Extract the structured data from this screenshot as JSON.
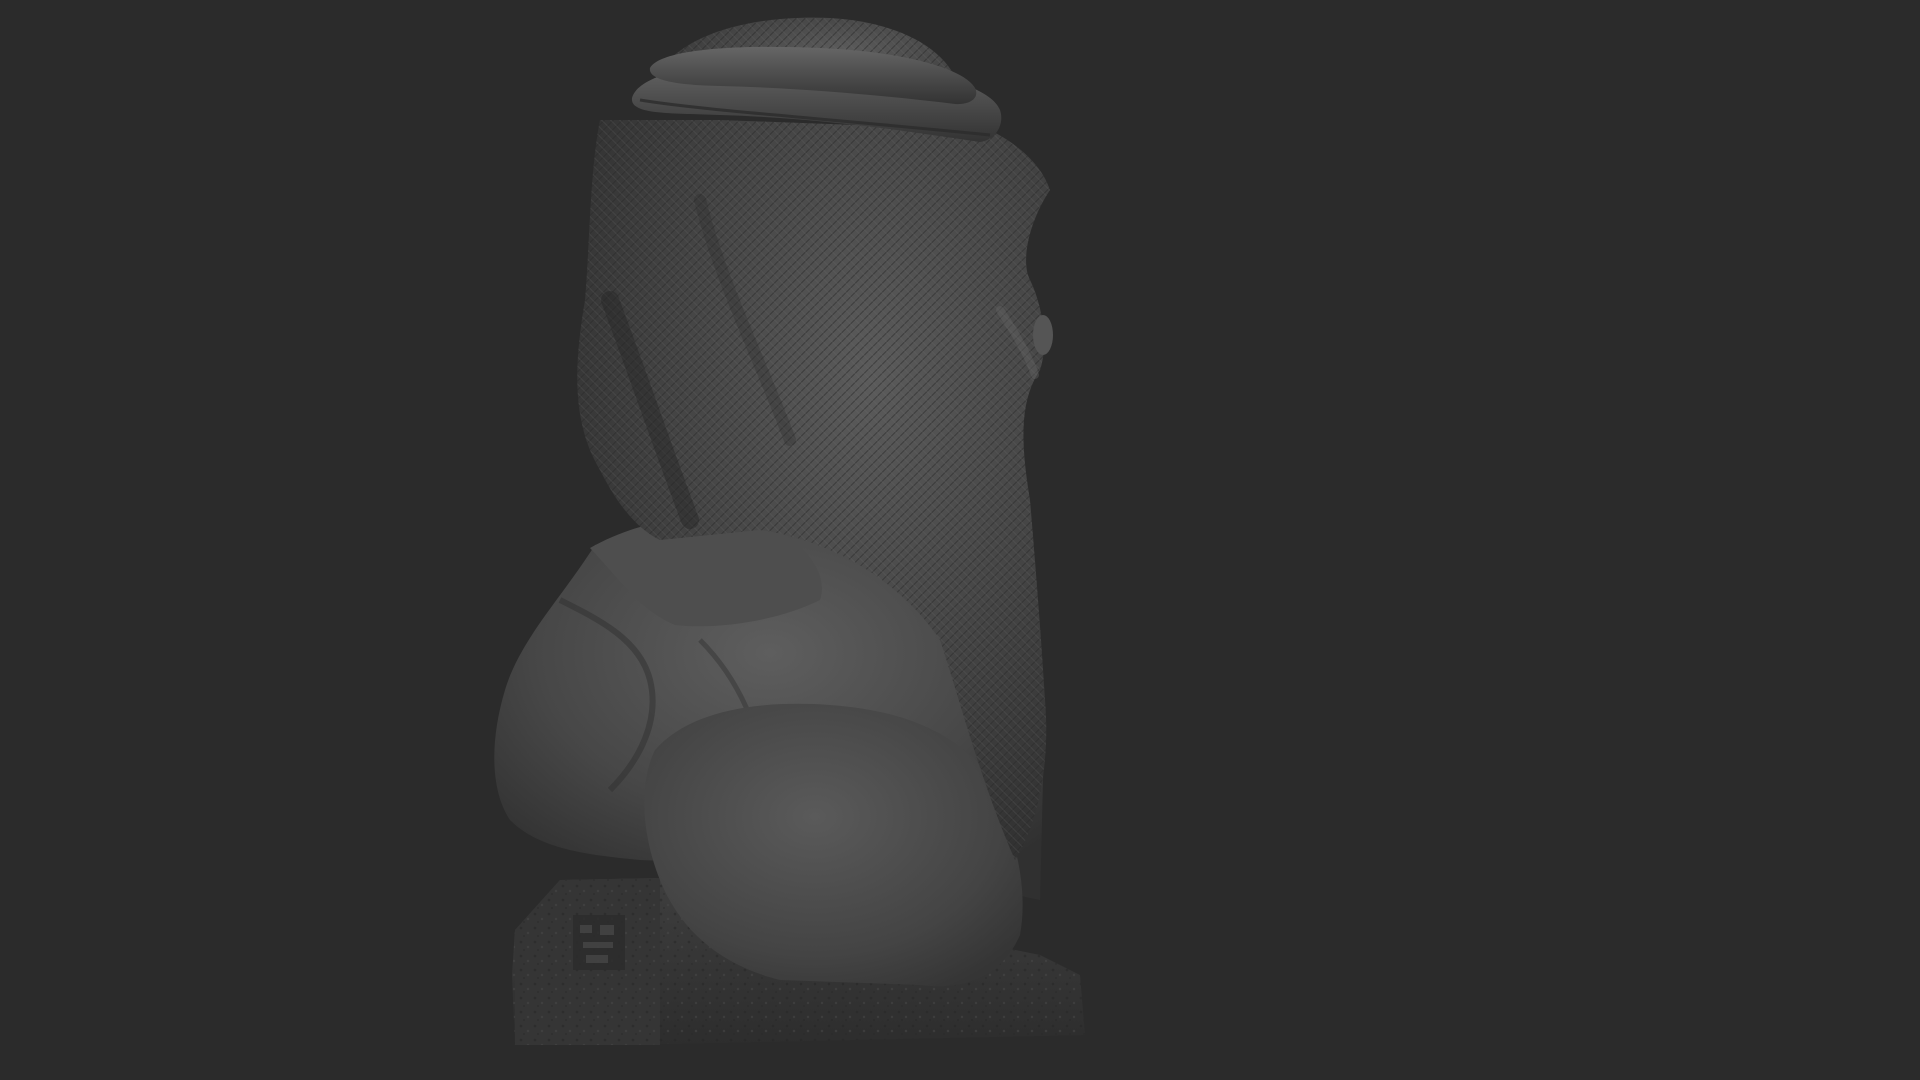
{
  "scene": {
    "subject": "bust-sculpture",
    "colors": {
      "background": "#2b2b2b",
      "clay_dark": "#2e2e2e",
      "clay_mid": "#454545",
      "clay_light": "#5a5a5a",
      "clay_highlight": "#6e6e6e"
    }
  }
}
